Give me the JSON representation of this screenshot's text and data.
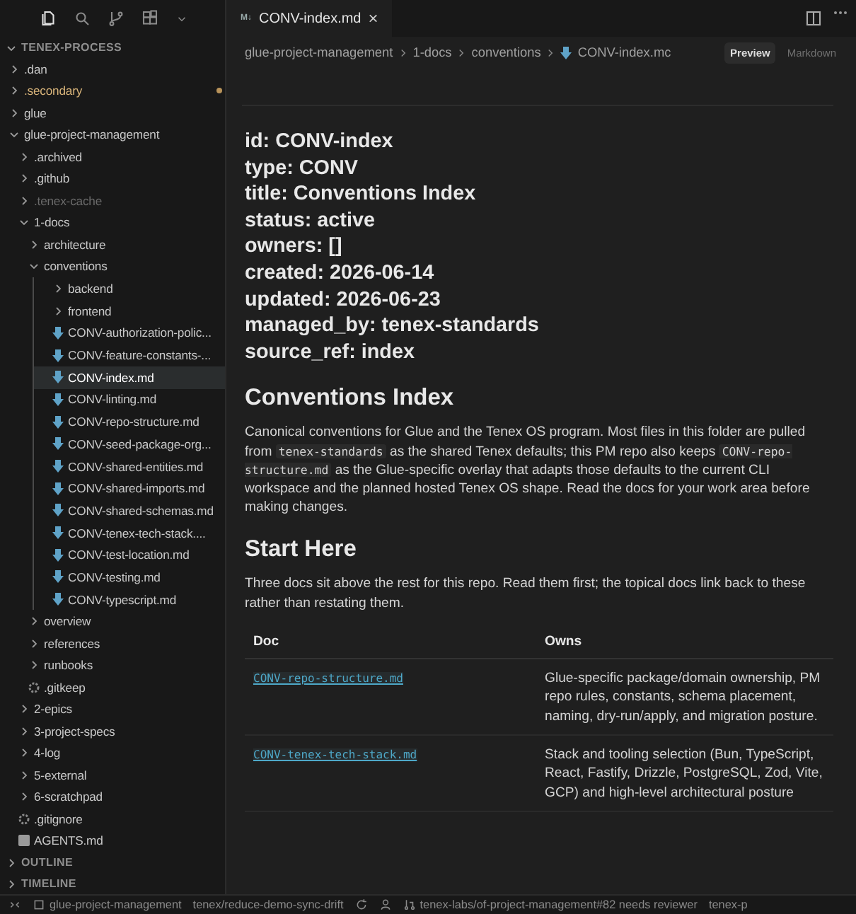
{
  "activity_bar": {
    "items": [
      {
        "selected": true
      },
      {
        "selected": false
      },
      {
        "selected": false
      },
      {
        "selected": false
      },
      {
        "selected": false
      }
    ]
  },
  "explorer": {
    "title": "TENEX-PROCESS",
    "expanded": true,
    "tree": [
      {
        "label": ".dan",
        "kind": "folder",
        "expanded": false
      },
      {
        "label": ".secondary",
        "kind": "folder",
        "expanded": false,
        "modified": true
      },
      {
        "label": "glue",
        "kind": "folder",
        "expanded": false
      },
      {
        "label": "glue-project-management",
        "kind": "folder",
        "expanded": true,
        "children": [
          {
            "label": ".archived",
            "kind": "folder",
            "expanded": false
          },
          {
            "label": ".github",
            "kind": "folder",
            "expanded": false
          },
          {
            "label": ".tenex-cache",
            "kind": "folder",
            "expanded": false,
            "ignored": true
          },
          {
            "label": "1-docs",
            "kind": "folder",
            "expanded": true,
            "children": [
              {
                "label": "architecture",
                "kind": "folder",
                "expanded": false
              },
              {
                "label": "conventions",
                "kind": "folder",
                "expanded": true,
                "children": [
                  {
                    "label": "backend",
                    "kind": "folder",
                    "expanded": false
                  },
                  {
                    "label": "frontend",
                    "kind": "folder",
                    "expanded": false
                  },
                  {
                    "label": "CONV-authorization-polic...",
                    "kind": "markdown",
                    "selected": false
                  },
                  {
                    "label": "CONV-feature-constants-...",
                    "kind": "markdown",
                    "selected": false
                  },
                  {
                    "label": "CONV-index.md",
                    "kind": "markdown",
                    "selected": true
                  },
                  {
                    "label": "CONV-linting.md",
                    "kind": "markdown",
                    "selected": false
                  },
                  {
                    "label": "CONV-repo-structure.md",
                    "kind": "markdown",
                    "selected": false
                  },
                  {
                    "label": "CONV-seed-package-org...",
                    "kind": "markdown",
                    "selected": false
                  },
                  {
                    "label": "CONV-shared-entities.md",
                    "kind": "markdown",
                    "selected": false
                  },
                  {
                    "label": "CONV-shared-imports.md",
                    "kind": "markdown",
                    "selected": false
                  },
                  {
                    "label": "CONV-shared-schemas.md",
                    "kind": "markdown",
                    "selected": false
                  },
                  {
                    "label": "CONV-tenex-tech-stack....",
                    "kind": "markdown",
                    "selected": false
                  },
                  {
                    "label": "CONV-test-location.md",
                    "kind": "markdown",
                    "selected": false
                  },
                  {
                    "label": "CONV-testing.md",
                    "kind": "markdown",
                    "selected": false
                  },
                  {
                    "label": "CONV-typescript.md",
                    "kind": "markdown",
                    "selected": false
                  }
                ]
              },
              {
                "label": "overview",
                "kind": "folder",
                "expanded": false
              },
              {
                "label": "references",
                "kind": "folder",
                "expanded": false
              },
              {
                "label": "runbooks",
                "kind": "folder",
                "expanded": false
              },
              {
                "label": ".gitkeep",
                "kind": "config",
                "selected": false
              }
            ]
          },
          {
            "label": "2-epics",
            "kind": "folder",
            "expanded": false
          },
          {
            "label": "3-project-specs",
            "kind": "folder",
            "expanded": false
          },
          {
            "label": "4-log",
            "kind": "folder",
            "expanded": false
          },
          {
            "label": "5-external",
            "kind": "folder",
            "expanded": false
          },
          {
            "label": "6-scratchpad",
            "kind": "folder",
            "expanded": false
          },
          {
            "label": ".gitignore",
            "kind": "config",
            "selected": false
          },
          {
            "label": "AGENTS.md",
            "kind": "agents",
            "selected": false
          }
        ]
      }
    ]
  },
  "panels": [
    {
      "title": "OUTLINE",
      "expanded": false
    },
    {
      "title": "TIMELINE",
      "expanded": false
    }
  ],
  "tab": {
    "label": "CONV-index.md",
    "badge": "M↓",
    "close": "×"
  },
  "breadcrumb": [
    "glue-project-management",
    "1-docs",
    "conventions",
    "CONV-index.mc"
  ],
  "view_toggle": [
    {
      "label": "Preview",
      "selected": true
    },
    {
      "label": "Markdown",
      "selected": false
    }
  ],
  "frontmatter": [
    "id: CONV-index",
    "type: CONV",
    "title: Conventions Index",
    "status: active",
    "owners: []",
    "created: 2026-06-14",
    "updated: 2026-06-23",
    "managed_by: tenex-standards",
    "source_ref: index"
  ],
  "sections": [
    {
      "heading": "Conventions Index",
      "paragraph": [
        {
          "text": "Canonical conventions for Glue and the Tenex OS program. Most files in this folder are pulled from ",
          "code": false
        },
        {
          "text": "tenex-standards",
          "code": true
        },
        {
          "text": " as the shared Tenex defaults; this PM repo also keeps ",
          "code": false
        },
        {
          "text": "CONV-repo-structure.md",
          "code": true
        },
        {
          "text": " as the Glue-specific overlay that adapts those defaults to the current CLI workspace and the planned hosted Tenex OS shape. Read the docs for your work area before making changes.",
          "code": false
        }
      ]
    },
    {
      "heading": "Start Here",
      "paragraph": [
        {
          "text": "Three docs sit above the rest for this repo. Read them first; the topical docs link back to these rather than restating them.",
          "code": false
        }
      ]
    }
  ],
  "table": {
    "columns": [
      "Doc",
      "Owns"
    ],
    "rows": [
      {
        "doc": "CONV-repo-structure.md",
        "owns": "Glue-specific package/domain ownership, PM repo rules, constants, schema placement, naming, dry-run/apply, and migration posture."
      },
      {
        "doc": "CONV-tenex-tech-stack.md",
        "owns": "Stack and tooling selection (Bun, TypeScript, React, Fastify, Drizzle, PostgreSQL, Zod, Vite, GCP) and high-level architectural posture"
      }
    ]
  },
  "status_bar": [
    {
      "kind": "remote"
    },
    {
      "kind": "repo",
      "text": "glue-project-management"
    },
    {
      "kind": "branch",
      "text": "tenex/reduce-demo-sync-drift"
    },
    {
      "kind": "sync"
    },
    {
      "kind": "account"
    },
    {
      "kind": "pr",
      "text": "tenex-labs/of-project-management#82 needs reviewer"
    },
    {
      "kind": "plain",
      "text": "tenex-p"
    }
  ]
}
